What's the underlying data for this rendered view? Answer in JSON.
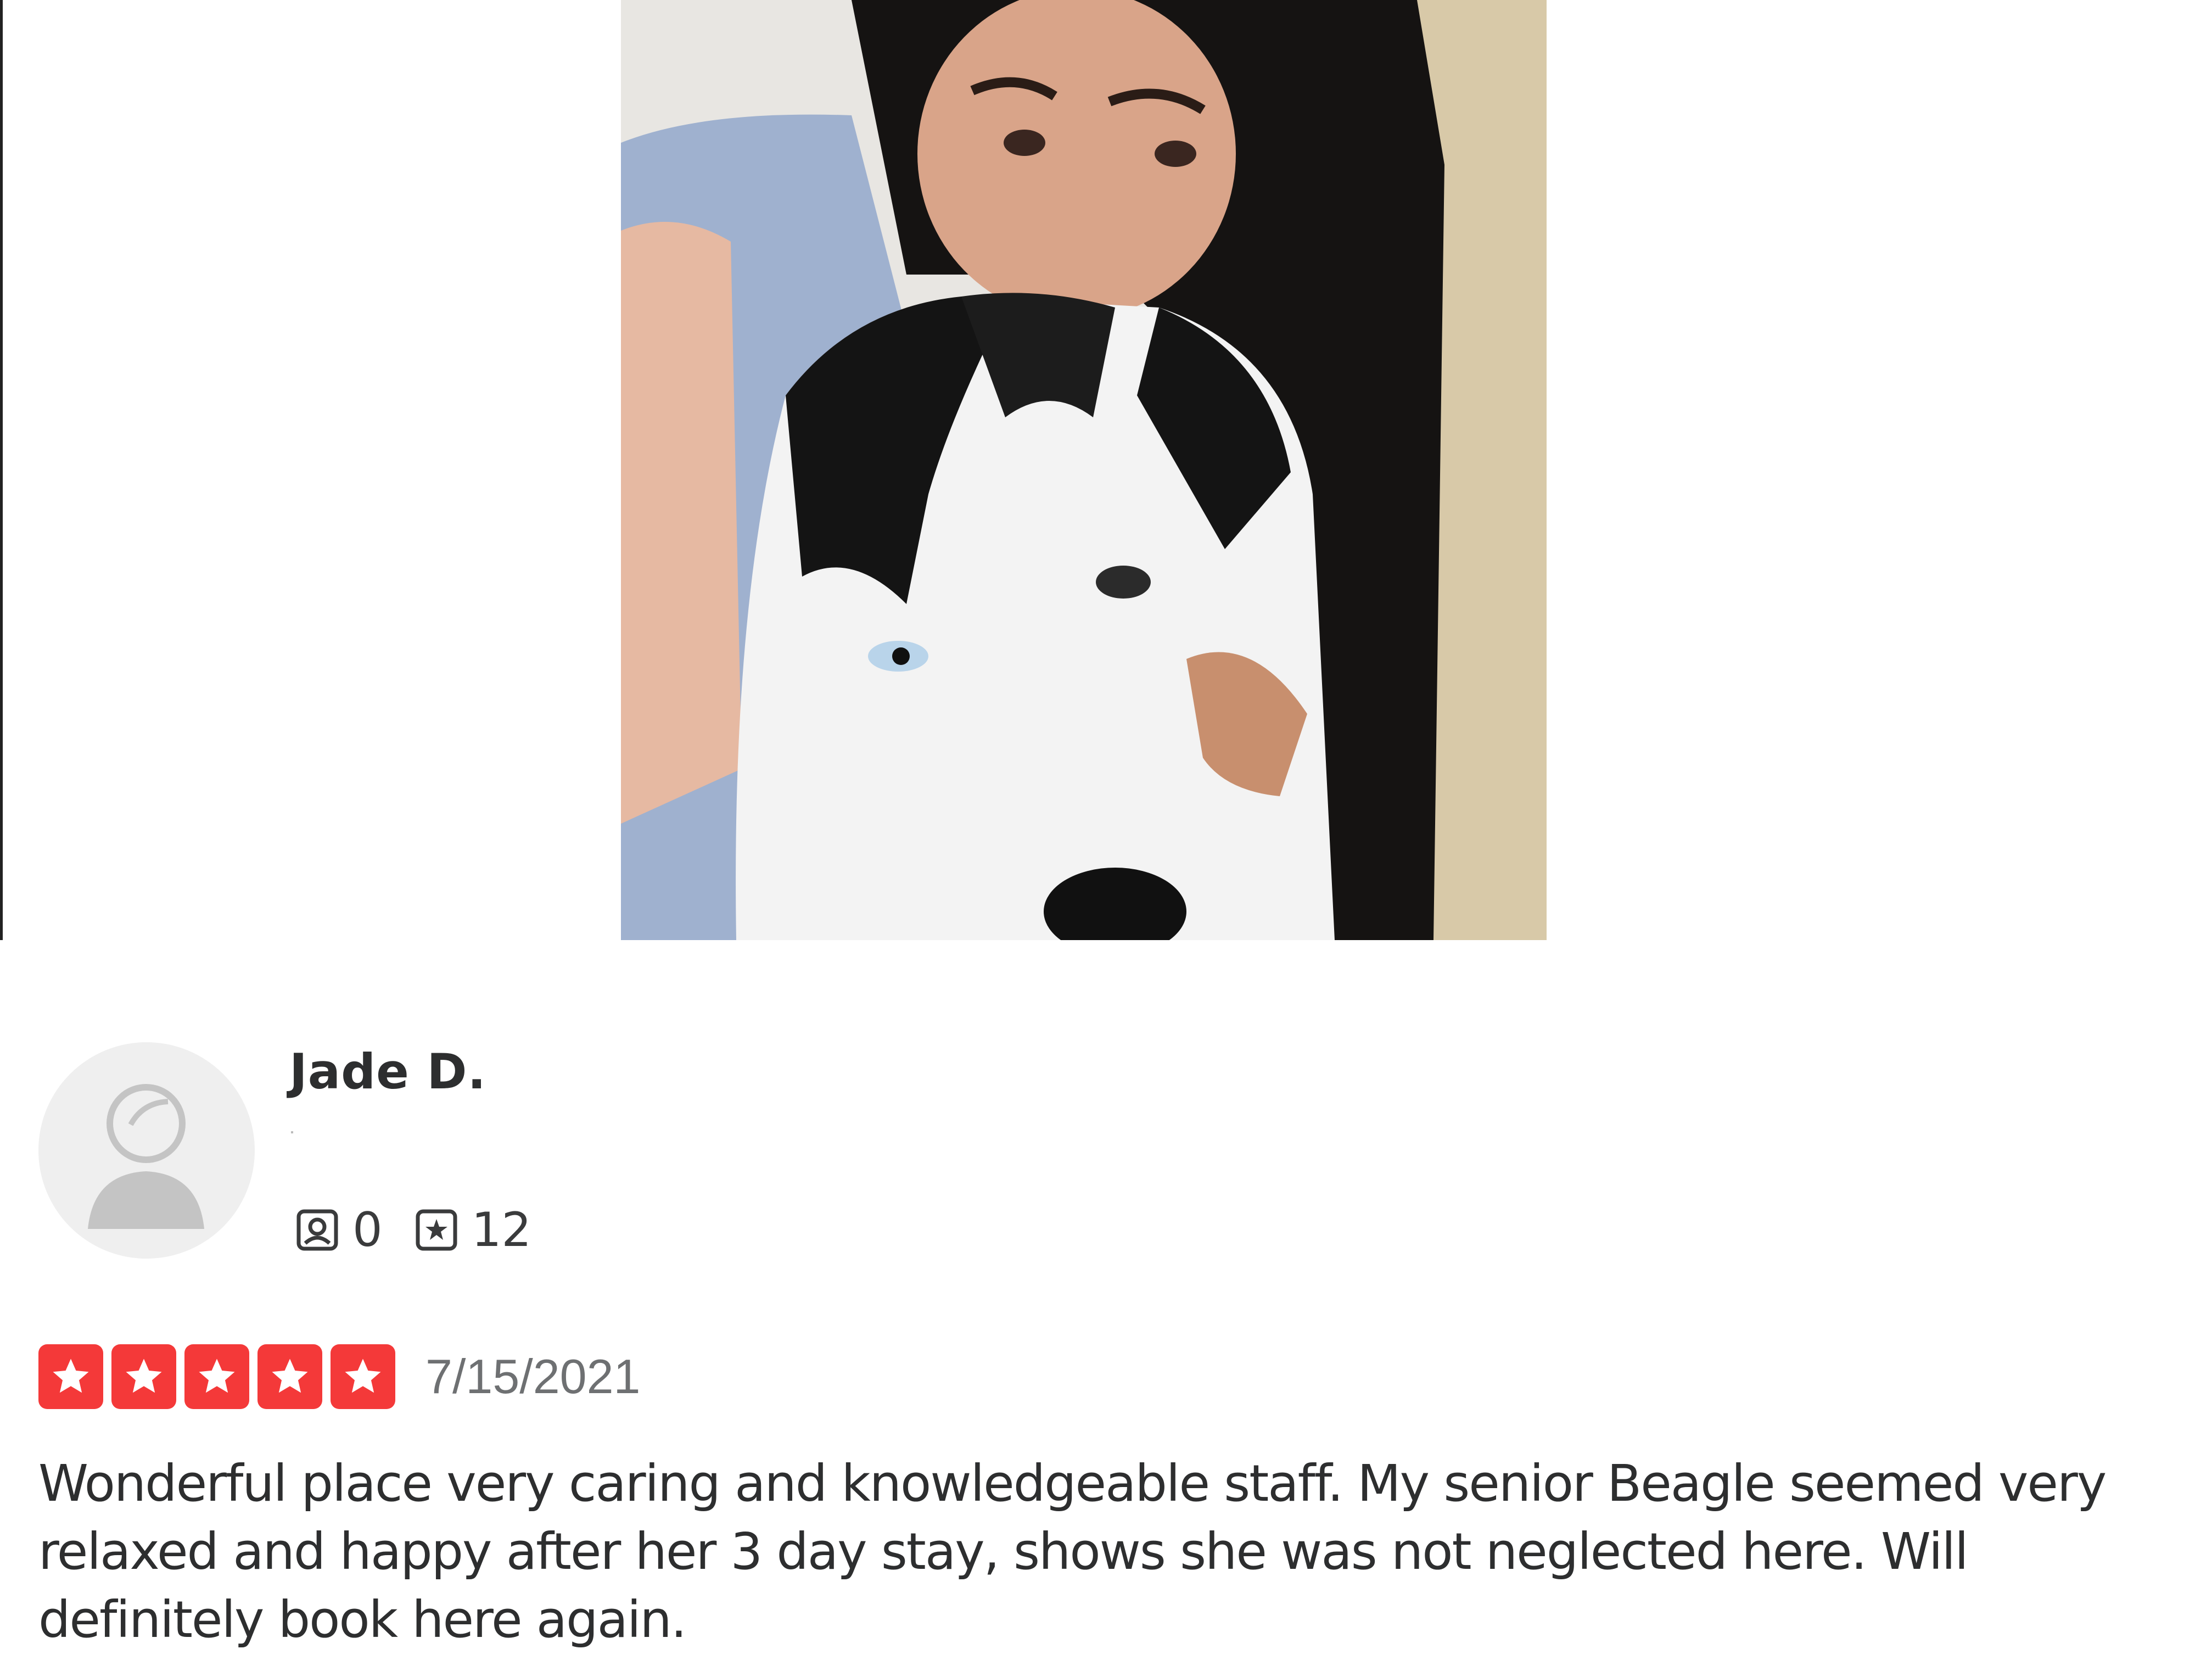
{
  "review": {
    "user_name": "Jade D.",
    "friends_count": "0",
    "reviews_count": "12",
    "rating": 5,
    "rating_max": 5,
    "date": "7/15/2021",
    "text": "Wonderful place very caring and knowledgeable staff. My senior Beagle seemed very relaxed and happy after her 3 day stay, shows she was not neglected here. Will definitely book here again."
  },
  "icons": {
    "friends": "friends-icon",
    "reviews": "reviews-icon",
    "star": "star-icon",
    "avatar": "default-avatar-icon"
  },
  "colors": {
    "star_background": "#f43939",
    "text": "#2d2e2f",
    "date": "#6e7072"
  }
}
